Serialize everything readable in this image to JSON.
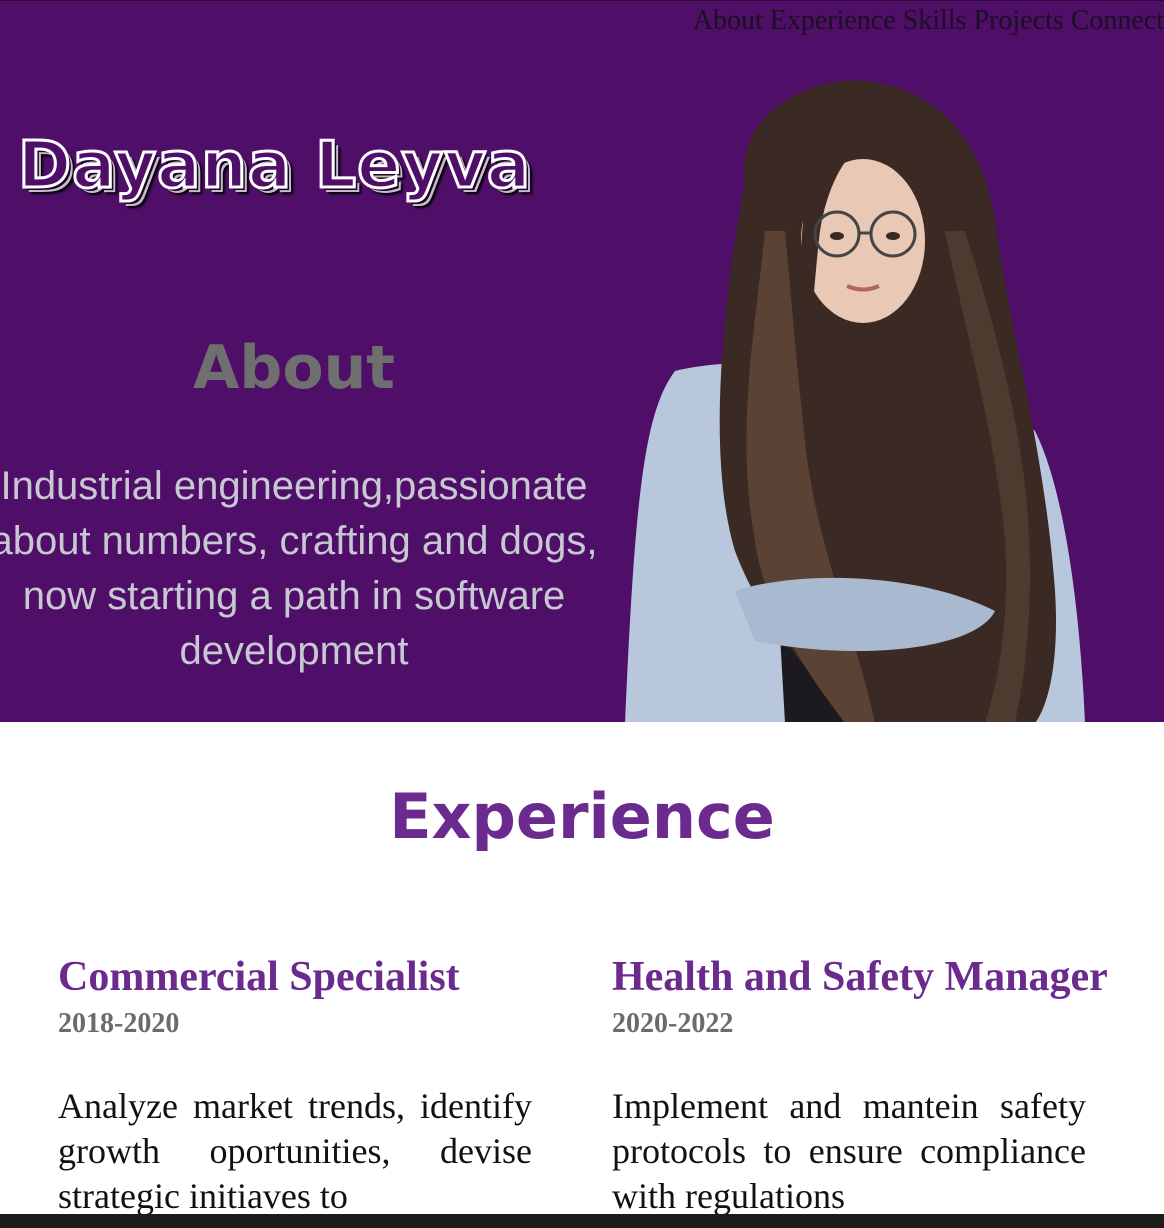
{
  "nav": {
    "items": [
      "About",
      "Experience",
      "Skills",
      "Projects",
      "Connect"
    ]
  },
  "hero": {
    "name": "Dayana Leyva",
    "about_title": "About",
    "about_text": "Industrial engineering,passionate about numbers, crafting and dogs, now starting a path in software development",
    "background_color": "#4f0f68"
  },
  "experience": {
    "title": "Experience",
    "jobs": [
      {
        "title": "Commercial Specialist",
        "years": "2018-2020",
        "description": "Analyze market trends, identify growth oportunities, devise strategic initiaves to"
      },
      {
        "title": "Health and Safety Manager",
        "years": "2020-2022",
        "description": "Implement and mantein safety protocols to ensure compliance with regulations"
      }
    ]
  },
  "colors": {
    "accent": "#6a2a8e",
    "muted": "#6b6b6b"
  }
}
